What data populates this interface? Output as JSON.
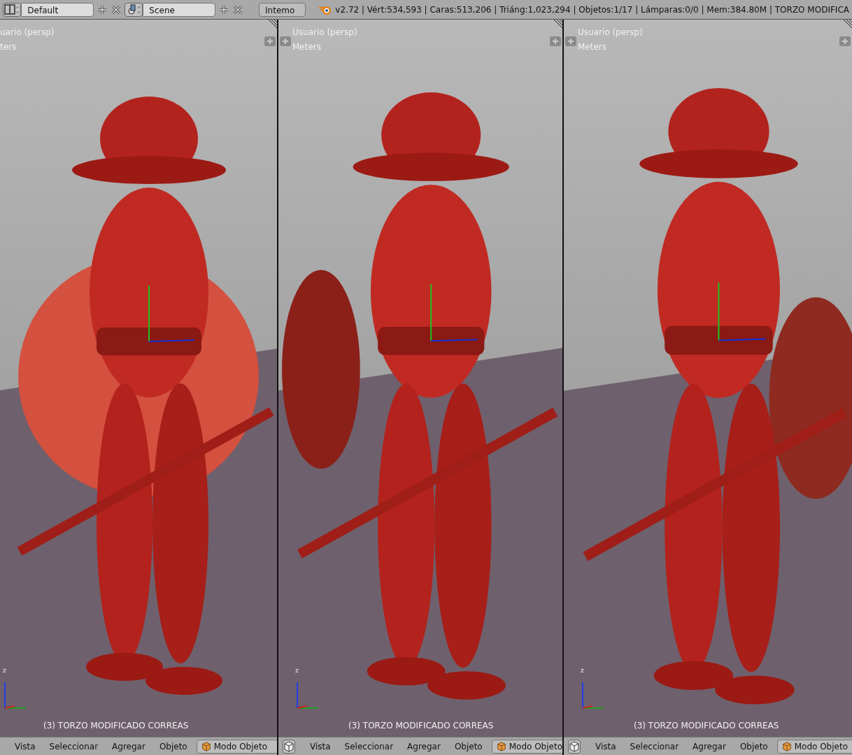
{
  "topbar": {
    "layout": "Default",
    "scene": "Scene",
    "engine": "Intemo",
    "stats": "v2.72 | Vért:534,593 | Caras:513,206 | Triáng:1,023,294 | Objetos:1/17 | Lámparas:0/0 | Mem:384.80M | TORZO MODIFICA"
  },
  "viewports": [
    {
      "view": "uario (persp)",
      "units": "ters",
      "axis_label": "z",
      "object": "(3) TORZO MODIFICADO CORREAS",
      "editor_button": false,
      "menus": [
        "Vista",
        "Seleccionar",
        "Agregar",
        "Objeto"
      ],
      "mode": "Modo Objeto"
    },
    {
      "view": "Usuario (persp)",
      "units": "Meters",
      "axis_label": "z",
      "object": "(3) TORZO MODIFICADO CORREAS",
      "editor_button": true,
      "menus": [
        "Vista",
        "Seleccionar",
        "Agregar",
        "Objeto"
      ],
      "mode": "Modo Objeto"
    },
    {
      "view": "Usuario (persp)",
      "units": "Meters",
      "axis_label": "z",
      "object": "(3) TORZO MODIFICADO CORREAS",
      "editor_button": true,
      "menus": [
        "Vista",
        "Seleccionar",
        "Agregar",
        "Objeto"
      ],
      "mode": "Modo Objeto"
    }
  ]
}
